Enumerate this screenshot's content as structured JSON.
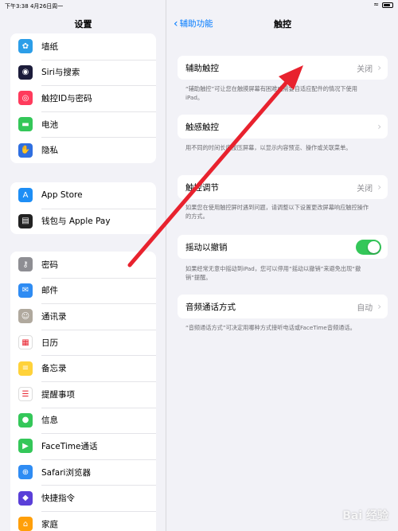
{
  "status_bar": {
    "time": "下午3:38  4月26日周一"
  },
  "sidebar": {
    "title": "设置",
    "group1": [
      {
        "label": "墙纸",
        "icon": "wallpaper-icon",
        "color": "#2c9ee8"
      },
      {
        "label": "Siri与搜索",
        "icon": "siri-icon",
        "color": "#1c1c3a"
      },
      {
        "label": "触控ID与密码",
        "icon": "fingerprint-icon",
        "color": "#ff3b5c"
      },
      {
        "label": "电池",
        "icon": "battery-icon",
        "color": "#34c759"
      },
      {
        "label": "隐私",
        "icon": "hand-icon",
        "color": "#2f6fe0"
      }
    ],
    "group2": [
      {
        "label": "App Store",
        "icon": "app-store-icon",
        "color": "#1e8ef5"
      },
      {
        "label": "钱包与 Apple Pay",
        "icon": "wallet-icon",
        "color": "#222222"
      }
    ],
    "group3": [
      {
        "label": "密码",
        "icon": "key-icon",
        "color": "#8e8e93"
      },
      {
        "label": "邮件",
        "icon": "mail-icon",
        "color": "#2f8cf3"
      },
      {
        "label": "通讯录",
        "icon": "contacts-icon",
        "color": "#b0a99e"
      },
      {
        "label": "日历",
        "icon": "calendar-icon",
        "color": "#ffffff"
      },
      {
        "label": "备忘录",
        "icon": "notes-icon",
        "color": "#ffd23a"
      },
      {
        "label": "提醒事项",
        "icon": "reminders-icon",
        "color": "#ffffff"
      },
      {
        "label": "信息",
        "icon": "messages-icon",
        "color": "#34c759"
      },
      {
        "label": "FaceTime通话",
        "icon": "facetime-icon",
        "color": "#34c759"
      },
      {
        "label": "Safari浏览器",
        "icon": "safari-icon",
        "color": "#2f8cf3"
      },
      {
        "label": "快捷指令",
        "icon": "shortcuts-icon",
        "color": "#5a3fd8"
      },
      {
        "label": "家庭",
        "icon": "home-icon",
        "color": "#ff9f0a"
      }
    ]
  },
  "pane": {
    "back_label": "辅助功能",
    "title": "触控",
    "cells": [
      {
        "title": "辅助触控",
        "value": "关闭",
        "footnote": "“辅助触控”可让您在触摸屏幕有困难或需要自适应配件的情况下使用iPad。"
      },
      {
        "title": "触感触控",
        "value": "",
        "footnote": "用不同的时间长度按压屏幕，以显示内容预览、操作或关联菜单。"
      },
      {
        "title": "触控调节",
        "value": "关闭",
        "footnote": "如果您在使用触控屏时遇到问题，请调整以下设置更改屏幕响应触控操作的方式。"
      },
      {
        "title": "摇动以撤销",
        "value": "",
        "toggle_on": true,
        "footnote": "如果经常无意中摇动到iPad，您可以停用“摇动以撤销”来避免出现“撤销”提醒。"
      },
      {
        "title": "音频通话方式",
        "value": "自动",
        "footnote": "“音频通话方式”可决定用哪种方式接听电话或FaceTime音频通话。"
      }
    ]
  },
  "annotation": {
    "arrow_color": "#e8222e"
  },
  "watermark": "Bai 经验"
}
